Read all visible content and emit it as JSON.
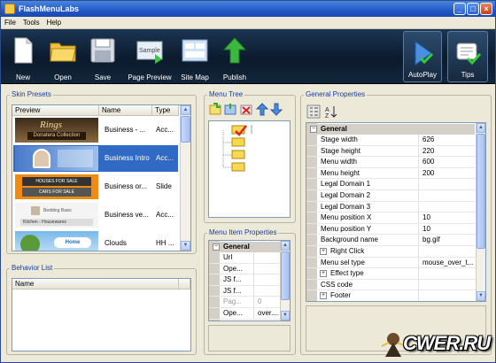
{
  "window": {
    "title": "FlashMenuLabs",
    "controls": {
      "minimize": "_",
      "maximize": "□",
      "close": "×"
    }
  },
  "menubar": [
    "File",
    "Tools",
    "Help"
  ],
  "toolbar": {
    "new": "New",
    "open": "Open",
    "save": "Save",
    "page_preview": "Page Preview",
    "page_preview_icon_text": "Sample",
    "site_map": "Site Map",
    "publish": "Publish",
    "autoplay": "AutoPlay",
    "tips": "Tips"
  },
  "skin_presets": {
    "title": "Skin Presets",
    "columns": [
      "Preview",
      "Name",
      "Type"
    ],
    "rows": [
      {
        "name": "Business - ...",
        "type": "Acc...",
        "thumb_text": "Rings",
        "thumb_sub": "Donatera Collection"
      },
      {
        "name": "Business Intro",
        "type": "Acc...",
        "thumb_text": "",
        "thumb_sub": ""
      },
      {
        "name": "Business or...",
        "type": "Slide",
        "thumb_text": "HOUSES FOR SALE",
        "thumb_sub": "CARS FOR SALE"
      },
      {
        "name": "Business ve...",
        "type": "Acc...",
        "thumb_text": "Kitchen - Housewares",
        "thumb_sub": "Bedding Basic"
      },
      {
        "name": "Clouds",
        "type": "HH ...",
        "thumb_text": "Home",
        "thumb_sub": ""
      }
    ],
    "selected_index": 1
  },
  "behavior_list": {
    "title": "Behavior List",
    "columns": [
      "Name"
    ]
  },
  "menu_tree": {
    "title": "Menu Tree"
  },
  "menu_item_properties": {
    "title": "Menu Item Properties",
    "category": "General",
    "rows": [
      {
        "key": "Url",
        "value": ""
      },
      {
        "key": "Ope...",
        "value": ""
      },
      {
        "key": "JS f...",
        "value": ""
      },
      {
        "key": "JS f...",
        "value": ""
      },
      {
        "key": "Pag...",
        "value": "0"
      },
      {
        "key": "Ope...",
        "value": "over...."
      }
    ]
  },
  "general_properties": {
    "title": "General Properties",
    "category": "General",
    "rows": [
      {
        "key": "Stage width",
        "value": "626",
        "expand": false
      },
      {
        "key": "Stage height",
        "value": "220",
        "expand": false
      },
      {
        "key": "Menu width",
        "value": "600",
        "expand": false
      },
      {
        "key": "Menu height",
        "value": "200",
        "expand": false
      },
      {
        "key": "Legal Domain 1",
        "value": "",
        "expand": false
      },
      {
        "key": "Legal Domain 2",
        "value": "",
        "expand": false
      },
      {
        "key": "Legal Domain 3",
        "value": "",
        "expand": false
      },
      {
        "key": "Menu position X",
        "value": "10",
        "expand": false
      },
      {
        "key": "Menu position Y",
        "value": "10",
        "expand": false
      },
      {
        "key": "Background name",
        "value": "bg.gif",
        "expand": false
      },
      {
        "key": "Right Click",
        "value": "",
        "expand": true
      },
      {
        "key": "Menu sel type",
        "value": "mouse_over_t...",
        "expand": false
      },
      {
        "key": "Effect type",
        "value": "",
        "expand": true
      },
      {
        "key": "CSS code",
        "value": "",
        "expand": false
      },
      {
        "key": "Footer",
        "value": "",
        "expand": true
      }
    ]
  },
  "watermark": "CWER.RU",
  "colors": {
    "selection": "#316ac5",
    "toolbar_dark": "#0b1a2c",
    "panel_title": "#1a3e9a"
  }
}
